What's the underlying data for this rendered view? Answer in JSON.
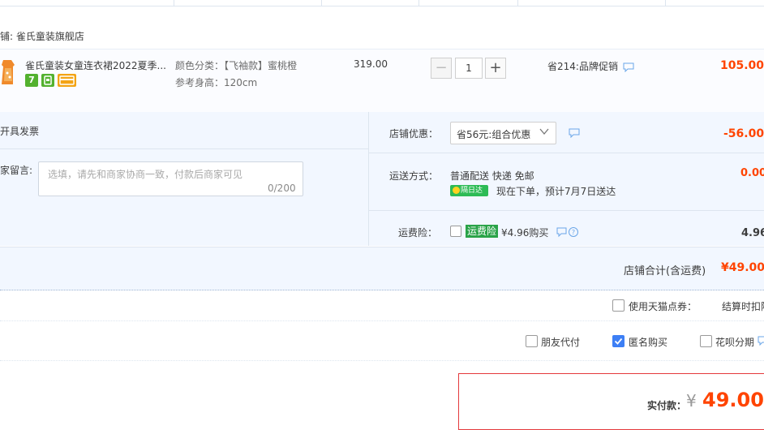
{
  "shop": {
    "name": "铺: 雀氏童装旗舰店"
  },
  "item": {
    "title": "雀氏童装女童连衣裙2022夏季...",
    "badges": [
      "7",
      "⬛",
      "▭"
    ],
    "spec_color": "颜色分类：【飞袖款】蜜桃橙",
    "spec_height": "参考身高：120cm",
    "unit_price": "319.00",
    "quantity": "1",
    "qty_minus": "−",
    "qty_plus": "+",
    "promotion": "省214:品牌促销",
    "subtotal": "105.00"
  },
  "invoice": {
    "label": "开具发票"
  },
  "message": {
    "label": "家留言:",
    "placeholder": "选填，请先和商家协商一致，付款后商家可见",
    "count": "0/200"
  },
  "shop_discount": {
    "label": "店铺优惠：",
    "selected": "省56元:组合优惠",
    "amount": "-56.00"
  },
  "shipping": {
    "label": "运送方式：",
    "method": "普通配送 快递 免邮",
    "badge": "隔日达",
    "delivery_note": "现在下单，预计7月7日送达",
    "fee": "0.00"
  },
  "insurance": {
    "label": "运费险：",
    "badge": "运费险",
    "price": "¥4.96购买",
    "amount": "4.96"
  },
  "shop_total": {
    "label": "店铺合计(含运费)",
    "value": "¥49.00"
  },
  "tmall_points": {
    "label": "使用天猫点券：",
    "note": "结算时扣除"
  },
  "options": {
    "friend_pay": {
      "label": "朋友代付",
      "checked": false
    },
    "anonymous": {
      "label": "匿名购买",
      "checked": true
    },
    "huabei": {
      "label": "花呗分期",
      "checked": false
    }
  },
  "payment": {
    "label": "实付款：",
    "currency": "¥",
    "amount": "49.00"
  },
  "colors": {
    "accent": "#ff4400",
    "selection": "#3d7ff5",
    "section_bg": "#f2f7ff",
    "green": "#2dbb55"
  }
}
